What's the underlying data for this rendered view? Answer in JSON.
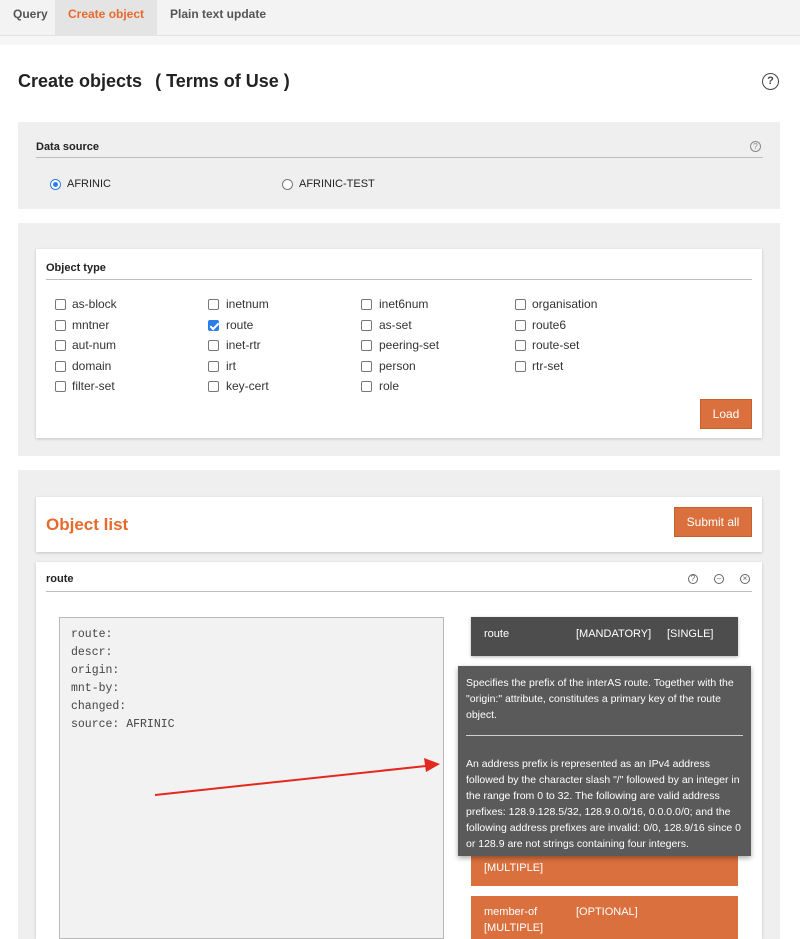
{
  "tabs": [
    {
      "label": "Query"
    },
    {
      "label": "Create object"
    },
    {
      "label": "Plain text update"
    }
  ],
  "header": {
    "title": "Create objects",
    "terms_link": "( Terms of Use )",
    "help_icon": "question-circle-icon"
  },
  "data_source": {
    "label": "Data source",
    "options": [
      {
        "label": "AFRINIC",
        "checked": true
      },
      {
        "label": "AFRINIC-TEST",
        "checked": false
      }
    ]
  },
  "object_type": {
    "label": "Object type",
    "columns": [
      [
        {
          "label": "as-block",
          "checked": false
        },
        {
          "label": "mntner",
          "checked": false
        },
        {
          "label": "aut-num",
          "checked": false
        },
        {
          "label": "domain",
          "checked": false
        },
        {
          "label": "filter-set",
          "checked": false
        }
      ],
      [
        {
          "label": "inetnum",
          "checked": false
        },
        {
          "label": "route",
          "checked": true
        },
        {
          "label": "inet-rtr",
          "checked": false
        },
        {
          "label": "irt",
          "checked": false
        },
        {
          "label": "key-cert",
          "checked": false
        }
      ],
      [
        {
          "label": "inet6num",
          "checked": false
        },
        {
          "label": "as-set",
          "checked": false
        },
        {
          "label": "peering-set",
          "checked": false
        },
        {
          "label": "person",
          "checked": false
        },
        {
          "label": "role",
          "checked": false
        }
      ],
      [
        {
          "label": "organisation",
          "checked": false
        },
        {
          "label": "route6",
          "checked": false
        },
        {
          "label": "route-set",
          "checked": false
        },
        {
          "label": "rtr-set",
          "checked": false
        }
      ]
    ],
    "load_button": "Load"
  },
  "object_list": {
    "title": "Object list",
    "submit_button": "Submit all"
  },
  "route_object": {
    "name": "route",
    "lines": [
      "route:",
      "descr:",
      "origin:",
      "mnt-by:",
      "changed:",
      "source: AFRINIC"
    ],
    "attribute": {
      "name": "route",
      "requirement": "[MANDATORY]",
      "cardinality": "[SINGLE]"
    },
    "tooltip": {
      "summary": "Specifies the prefix of the interAS route. Together with the \"origin:\" attribute, constitutes a primary key of the route object.",
      "detail": "An address prefix is represented as an IPv4 address followed by the character slash \"/\" followed by an integer in the range from 0 to 32. The following are valid address prefixes: 128.9.128.5/32, 128.9.0.0/16, 0.0.0.0/0; and the following address prefixes are invalid: 0/0, 128.9/16 since 0 or 128.9 are not strings containing four integers."
    },
    "partial_attribute": {
      "cardinality": "[MULTIPLE]"
    },
    "member_of": {
      "name": "member-of",
      "requirement": "[OPTIONAL]",
      "cardinality": "[MULTIPLE]"
    }
  },
  "colors": {
    "accent": "#e8692c",
    "button": "#d9703e",
    "tooltip": "#5a5a5a"
  }
}
